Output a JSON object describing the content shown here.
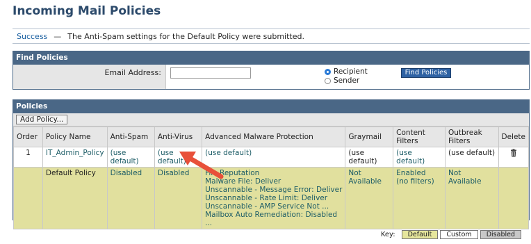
{
  "page": {
    "title": "Incoming Mail Policies"
  },
  "notice": {
    "status": "Success",
    "separator": "—",
    "message": "The Anti-Spam settings for the Default Policy were submitted."
  },
  "find": {
    "header": "Find Policies",
    "email_label": "Email Address:",
    "email_value": "",
    "radio_recipient": "Recipient",
    "radio_sender": "Sender",
    "selected_radio": "Recipient",
    "button": "Find Policies"
  },
  "policies": {
    "header": "Policies",
    "add_button": "Add Policy...",
    "columns": [
      "Order",
      "Policy Name",
      "Anti-Spam",
      "Anti-Virus",
      "Advanced Malware Protection",
      "Graymail",
      "Content Filters",
      "Outbreak Filters",
      "Delete"
    ],
    "rows": [
      {
        "order": "1",
        "name": "IT_Admin_Policy",
        "anti_spam": "(use default)",
        "anti_virus": "(use default)",
        "amp": "(use default)",
        "graymail": "(use default)",
        "content_filters": "(use default)",
        "outbreak_filters": "(use default)",
        "delete_icon": "trash-icon"
      },
      {
        "order": "",
        "name": "Default Policy",
        "anti_spam": "Disabled",
        "anti_virus": "Disabled",
        "amp_lines": [
          "File Reputation",
          "Malware File: Deliver",
          "Unscannable - Message Error: Deliver",
          "Unscannable - Rate Limit: Deliver",
          "Unscannable - AMP Service Not ...",
          "Mailbox Auto Remediation: Disabled",
          "..."
        ],
        "graymail": "Not Available",
        "content_filters_line1": "Enabled",
        "content_filters_line2": "(no filters)",
        "outbreak_filters": "Not Available"
      }
    ]
  },
  "key": {
    "label": "Key:",
    "default": "Default",
    "custom": "Custom",
    "disabled": "Disabled"
  },
  "colors": {
    "header_bg": "#4a6786",
    "default_row": "#e1e09e",
    "link": "#1c5c66",
    "annotation_arrow": "#e8503a"
  }
}
